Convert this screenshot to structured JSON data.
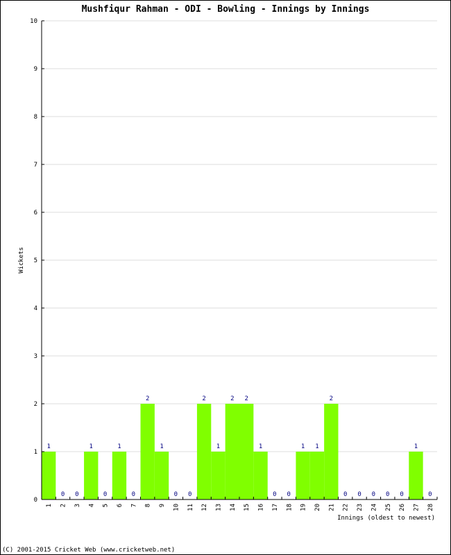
{
  "chart_data": {
    "type": "bar",
    "title": "Mushfiqur Rahman - ODI - Bowling - Innings by Innings",
    "xlabel": "Innings (oldest to newest)",
    "ylabel": "Wickets",
    "ylim": [
      0,
      10
    ],
    "yticks": [
      "0",
      "1",
      "2",
      "3",
      "4",
      "5",
      "6",
      "7",
      "8",
      "9",
      "10"
    ],
    "categories": [
      "1",
      "2",
      "3",
      "4",
      "5",
      "6",
      "7",
      "8",
      "9",
      "10",
      "11",
      "12",
      "13",
      "14",
      "15",
      "16",
      "17",
      "18",
      "19",
      "20",
      "21",
      "22",
      "23",
      "24",
      "25",
      "26",
      "27",
      "28"
    ],
    "values": [
      1,
      0,
      0,
      1,
      0,
      1,
      0,
      2,
      1,
      0,
      0,
      2,
      1,
      2,
      2,
      1,
      0,
      0,
      1,
      1,
      2,
      0,
      0,
      0,
      0,
      0,
      1,
      0
    ],
    "grid": true,
    "bar_color": "#80FF00",
    "label_color": "#000080"
  },
  "footer": "(C) 2001-2015 Cricket Web (www.cricketweb.net)"
}
